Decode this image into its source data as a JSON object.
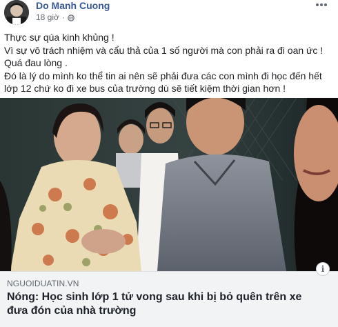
{
  "post": {
    "author": "Do Manh Cuong",
    "time": "18 giờ",
    "privacy_icon": "globe-icon",
    "more_icon": "more-options-icon",
    "lines": [
      "Thực sự qúa kinh khủng !",
      "Vì sự vô trách nhiệm và cẩu thả của 1 số người mà con phải ra đi oan ức !",
      "Quá đau lòng .",
      "Đó là lý do mình ko thể tin ai nên sẽ phải đưa các con mình đi học đến hết lớp 12 chứ ko đi xe bus của trường dù sẽ tiết kiệm thời gian hơn !"
    ]
  },
  "link": {
    "domain": "NGUOIDUATIN.VN",
    "headline": "Nóng: Học sinh lớp 1 tử vong sau khi bị bỏ quên trên xe đưa đón của nhà trường",
    "info_label": "i"
  },
  "colors": {
    "author": "#385898",
    "meta": "#616770",
    "link_bg": "#f2f3f5"
  }
}
